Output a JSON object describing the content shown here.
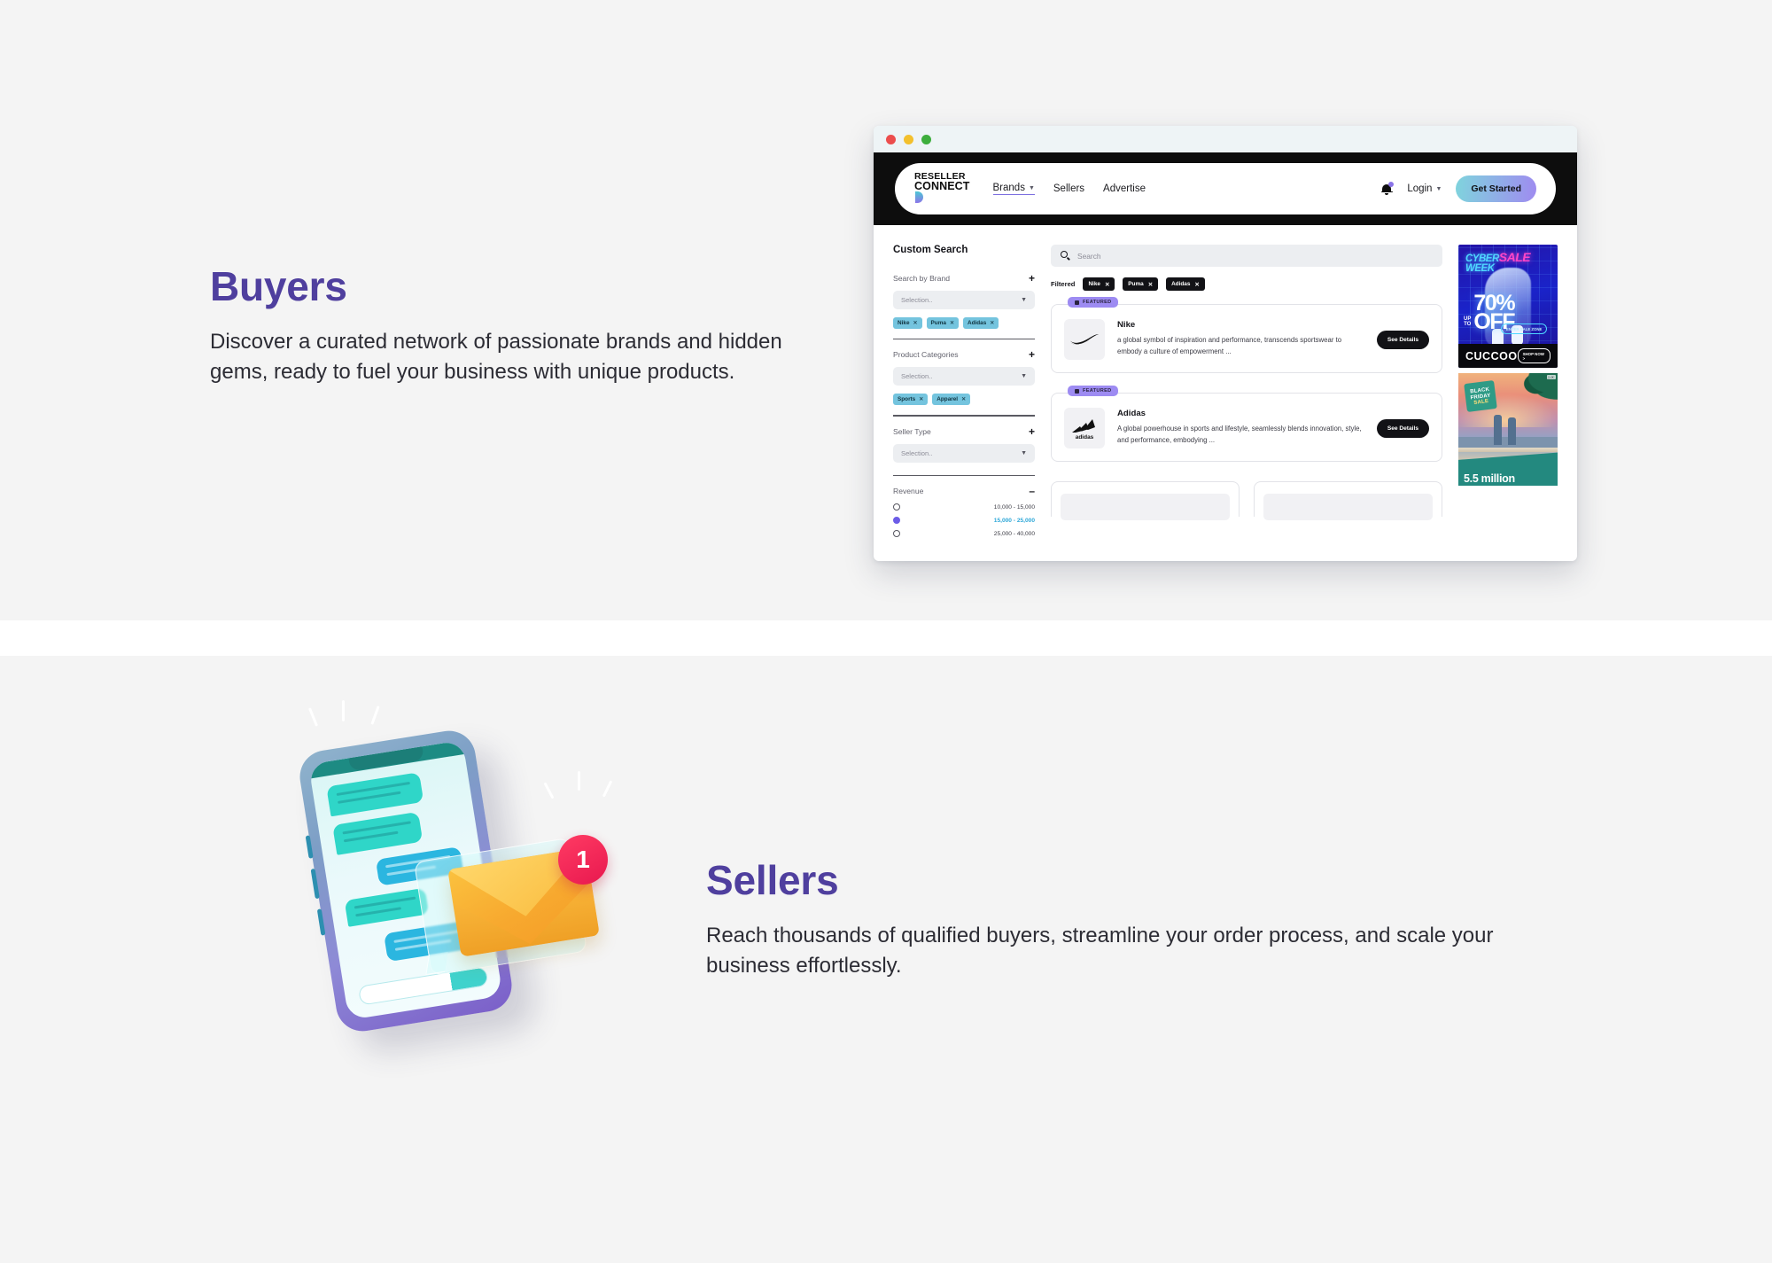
{
  "sections": {
    "buyers": {
      "heading": "Buyers",
      "body": "Discover a curated network of passionate brands and hidden gems, ready to fuel your business with unique products."
    },
    "sellers": {
      "heading": "Sellers",
      "body": "Reach thousands of qualified buyers, streamline your order process, and scale your business effortlessly."
    }
  },
  "colors": {
    "heading": "#4f3f9e",
    "section_bg": "#f4f4f4",
    "navbar_bg": "#0d0d0d",
    "cta_gradient_start": "#7fd4dd",
    "cta_gradient_end": "#9f8bf0",
    "chip_blue": "#74c4de",
    "badge_purple": "#9d8bf2",
    "selected_revenue": "#2fa8d8",
    "notification_red": "#e8184f"
  },
  "browser": {
    "traffic_lights": [
      "close-red",
      "minimize-yellow",
      "maximize-green"
    ],
    "navbar": {
      "logo_line1": "RESELLER",
      "logo_line2": "CONNECT",
      "links": [
        {
          "label": "Brands",
          "has_caret": true,
          "active": true
        },
        {
          "label": "Sellers",
          "has_caret": false,
          "active": false
        },
        {
          "label": "Advertise",
          "has_caret": false,
          "active": false
        }
      ],
      "bell_icon": "bell-icon",
      "login_label": "Login",
      "cta_label": "Get Started"
    },
    "sidebar": {
      "title": "Custom Search",
      "groups": [
        {
          "label": "Search by Brand",
          "toggle": "+",
          "select_placeholder": "Selection..",
          "chips": [
            "Nike",
            "Puma",
            "Adidas"
          ]
        },
        {
          "label": "Product Categories",
          "toggle": "+",
          "select_placeholder": "Selection..",
          "chips": [
            "Sports",
            "Apparel"
          ]
        },
        {
          "label": "Seller Type",
          "toggle": "+",
          "select_placeholder": "Selection..",
          "chips": []
        }
      ],
      "revenue": {
        "label": "Revenue",
        "toggle": "–",
        "options": [
          {
            "value": "10,000 - 15,000",
            "selected": false
          },
          {
            "value": "15,000 - 25,000",
            "selected": true
          },
          {
            "value": "25,000 - 40,000",
            "selected": false
          }
        ]
      }
    },
    "results": {
      "search_placeholder": "Search",
      "search_icon": "search-icon",
      "filtered_label": "Filtered",
      "filtered_chips": [
        "Nike",
        "Puma",
        "Adidas"
      ],
      "cards": [
        {
          "badge": "FEATURED",
          "name": "Nike",
          "description": "a global symbol of inspiration and performance, transcends sportswear to embody a culture of empowerment ...",
          "button": "See Details",
          "logo": "nike-swoosh-logo"
        },
        {
          "badge": "FEATURED",
          "name": "Adidas",
          "description": "A global powerhouse in sports and lifestyle, seamlessly blends innovation, style, and performance, embodying ...",
          "button": "See Details",
          "logo": "adidas-trefoil-logo"
        }
      ]
    },
    "ads": [
      {
        "id": "cyber-week-ad",
        "line1": "CYBER",
        "line2": "WEEK",
        "sale_word": "SALE",
        "up_to": "UP\nTO",
        "discount": "70% OFF",
        "cta_small": "ENTER SALE ZONE",
        "brand": "CUCCOO",
        "shop_label": "SHOP NOW >"
      },
      {
        "id": "black-friday-ad",
        "tag_line1": "BLACK",
        "tag_line2": "FRIDAY",
        "tag_line3": "SALE",
        "headline": "5.5 million",
        "ad_marker": "▷✕"
      }
    ]
  },
  "illustration": {
    "name": "phone-message-notification-illustration",
    "badge_count": "1",
    "envelope_icon": "envelope-icon",
    "phone_icon": "smartphone-icon"
  }
}
